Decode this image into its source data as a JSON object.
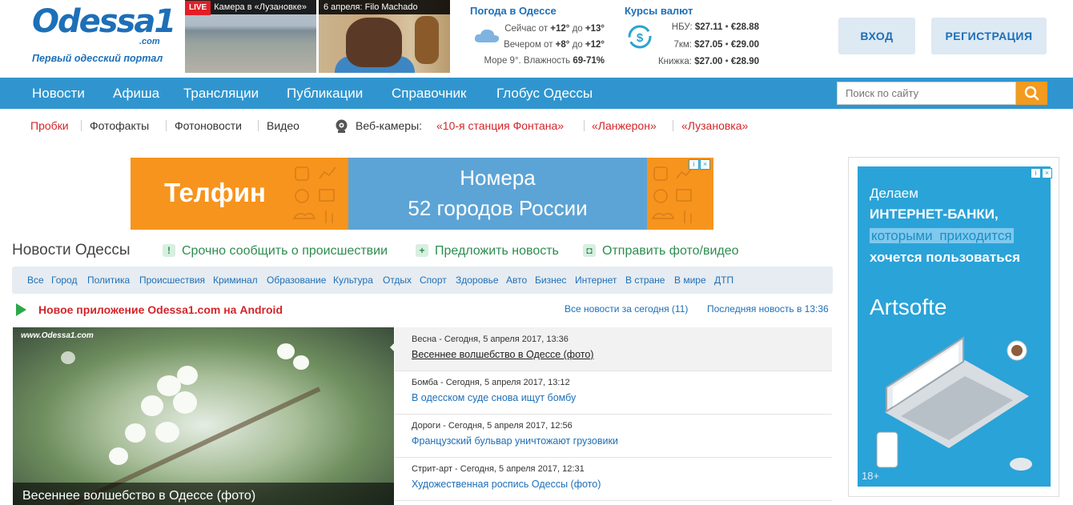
{
  "header": {
    "logo_word": "Odessa1",
    "logo_com": ".com",
    "tagline": "Первый одесский портал",
    "live_badge": "LIVE",
    "cam1_caption": "Камера в «Лузановке»",
    "cam2_caption": "6 апреля: Filo Machado",
    "weather": {
      "title": "Погода в Одессе",
      "now_prefix": "Сейчас от ",
      "now_from": "+12°",
      "now_mid": " до ",
      "now_to": "+13°",
      "evening_prefix": "Вечером от ",
      "evening_from": "+8°",
      "evening_mid": " до ",
      "evening_to": "+12°",
      "sea_prefix": "Море 9°. Влажность ",
      "humidity": "69-71%"
    },
    "rates": {
      "title": "Курсы валют",
      "rows": [
        {
          "label": "НБУ:",
          "usd": "$27.11",
          "eur": "€28.88"
        },
        {
          "label": "7км:",
          "usd": "$27.05",
          "eur": "€29.00"
        },
        {
          "label": "Книжка:",
          "usd": "$27.00",
          "eur": "€28.90"
        }
      ]
    },
    "login_label": "ВХОД",
    "register_label": "РЕГИСТРАЦИЯ"
  },
  "nav": {
    "items": [
      "Новости",
      "Афиша",
      "Трансляции",
      "Публикации",
      "Справочник",
      "Глобус Одессы"
    ],
    "search_placeholder": "Поиск по сайту"
  },
  "subnav": {
    "items": [
      "Пробки",
      "Фотофакты",
      "Фотоновости",
      "Видео"
    ],
    "webcams_label": "Веб-камеры:",
    "webcams": [
      "«10-я станция Фонтана»",
      "«Ланжерон»",
      "«Лузановка»"
    ]
  },
  "top_banner": {
    "brand": "Телфин",
    "line1": "Номера",
    "line2": "52 городов России"
  },
  "section": {
    "title": "Новости Одессы",
    "actions": [
      "Срочно сообщить о происшествии",
      "Предложить новость",
      "Отправить фото/видео"
    ],
    "action_icons": [
      "!",
      "+",
      "camera"
    ],
    "categories": [
      "Все",
      "Город",
      "Политика",
      "Происшествия",
      "Криминал",
      "Образование",
      "Культура",
      "Отдых",
      "Спорт",
      "Здоровье",
      "Авто",
      "Бизнес",
      "Интернет",
      "В стране",
      "В мире",
      "ДТП"
    ],
    "android_promo": "Новое приложение Odessa1.com на Android",
    "all_today": "Все новости за сегодня (11)",
    "last_news": "Последняя новость в 13:36"
  },
  "featured": {
    "watermark": "www.Odessa1.com",
    "caption": "Весеннее волшебство в Одессе (фото)"
  },
  "news": [
    {
      "meta": "Весна - Сегодня, 5 апреля 2017, 13:36",
      "title": "Весеннее волшебство в Одессе (фото)"
    },
    {
      "meta": "Бомба - Сегодня, 5 апреля 2017, 13:12",
      "title": "В одесском суде снова ищут бомбу"
    },
    {
      "meta": "Дороги - Сегодня, 5 апреля 2017, 12:56",
      "title": "Французский бульвар уничтожают грузовики"
    },
    {
      "meta": "Стрит-арт - Сегодня, 5 апреля 2017, 12:31",
      "title": "Художественная роспись Одессы (фото)"
    }
  ],
  "right_ad": {
    "line1": "Делаем",
    "line2": "ИНТЕРНЕТ-БАНКИ,",
    "line3_a": "которыми ",
    "line3_b": "приходится",
    "line4": "хочется пользоваться",
    "brand": "Artsofte",
    "age": "18+"
  },
  "colors": {
    "accent": "#1d6fb8",
    "nav_bg": "#3095cf",
    "search_button": "#f39a1f",
    "highlight_red": "#d3252a",
    "action_green": "#2c8d4f"
  }
}
